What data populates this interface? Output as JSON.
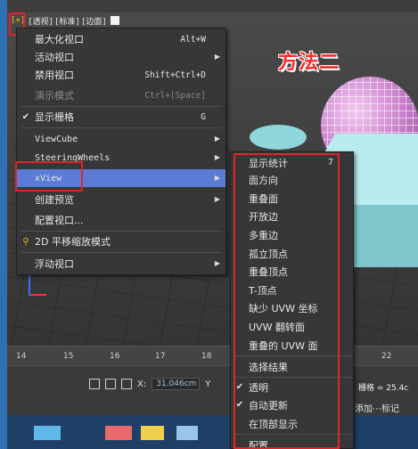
{
  "viewport": {
    "label_plus": "[+]",
    "label_view": "[透视]",
    "label_shading": "[标准]",
    "label_edges": "[边面]",
    "annotation_title": "方法二"
  },
  "main_menu": {
    "items": [
      {
        "label": "最大化视口",
        "accel": "Alt+W",
        "submenu": false,
        "checked": false,
        "disabled": false
      },
      {
        "label": "活动视口",
        "accel": "",
        "submenu": true,
        "checked": false,
        "disabled": false
      },
      {
        "label": "禁用视口",
        "accel": "Shift+Ctrl+D",
        "submenu": false,
        "checked": false,
        "disabled": false
      },
      {
        "label": "演示模式",
        "accel": "Ctrl+[Space]",
        "submenu": false,
        "checked": false,
        "disabled": true
      },
      {
        "label": "显示栅格",
        "accel": "G",
        "submenu": false,
        "checked": true,
        "disabled": false
      },
      {
        "label": "ViewCube",
        "accel": "",
        "submenu": true,
        "checked": false,
        "disabled": false
      },
      {
        "label": "SteeringWheels",
        "accel": "",
        "submenu": true,
        "checked": false,
        "disabled": false
      },
      {
        "label": "xView",
        "accel": "",
        "submenu": true,
        "checked": false,
        "disabled": false,
        "highlighted": true
      },
      {
        "label": "创建预览",
        "accel": "",
        "submenu": true,
        "checked": false,
        "disabled": false
      },
      {
        "label": "配置视口...",
        "accel": "",
        "submenu": false,
        "checked": false,
        "disabled": false
      },
      {
        "label": "2D 平移缩放模式",
        "accel": "",
        "submenu": false,
        "checked": false,
        "disabled": false,
        "icon": "magnifier-icon"
      },
      {
        "label": "浮动视口",
        "accel": "",
        "submenu": true,
        "checked": false,
        "disabled": false
      }
    ]
  },
  "xview_menu": {
    "items": [
      {
        "label": "显示统计",
        "accel": "7",
        "checked": false
      },
      {
        "label": "面方向",
        "accel": "",
        "checked": false
      },
      {
        "label": "重叠面",
        "accel": "",
        "checked": false
      },
      {
        "label": "开放边",
        "accel": "",
        "checked": false
      },
      {
        "label": "多重边",
        "accel": "",
        "checked": false
      },
      {
        "label": "孤立顶点",
        "accel": "",
        "checked": false
      },
      {
        "label": "重叠顶点",
        "accel": "",
        "checked": false
      },
      {
        "label": "T-顶点",
        "accel": "",
        "checked": false
      },
      {
        "label": "缺少 UVW 坐标",
        "accel": "",
        "checked": false
      },
      {
        "label": "UVW 翻转面",
        "accel": "",
        "checked": false
      },
      {
        "label": "重叠的 UVW 面",
        "accel": "",
        "checked": false
      },
      {
        "label": "选择结果",
        "accel": "",
        "checked": false
      },
      {
        "label": "透明",
        "accel": "",
        "checked": true
      },
      {
        "label": "自动更新",
        "accel": "",
        "checked": true
      },
      {
        "label": "在顶部显示",
        "accel": "",
        "checked": false
      },
      {
        "label": "配置",
        "accel": "",
        "checked": false
      }
    ]
  },
  "ruler": {
    "ticks": [
      "14",
      "15",
      "16",
      "17",
      "18",
      "22"
    ]
  },
  "status_bar": {
    "x_label": "X:",
    "x_value": "31.046cm",
    "y_label": "Y",
    "grid_readout": "栅格 = 25.4c",
    "add_marker": "添加⋯标记"
  },
  "colors": {
    "annotation_red": "#e0242c",
    "menu_highlight": "#5a7bd6",
    "menu_bg": "#373737"
  }
}
